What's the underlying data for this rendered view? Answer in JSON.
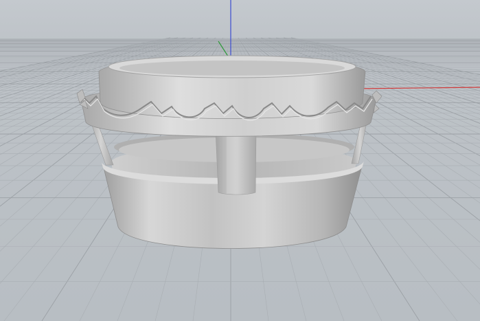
{
  "viewport": {
    "view": "perspective",
    "background": "#c0c5ca",
    "grid_minor_color": "#a9aeb3",
    "grid_major_color": "#9ba0a5",
    "axis_colors": {
      "x": "#d23b3b",
      "y": "#2f9a3a",
      "z": "#3b4bd0"
    }
  },
  "model": {
    "description_icon": "ring-crown-model-icon",
    "material_color": "#c9c9c9"
  }
}
